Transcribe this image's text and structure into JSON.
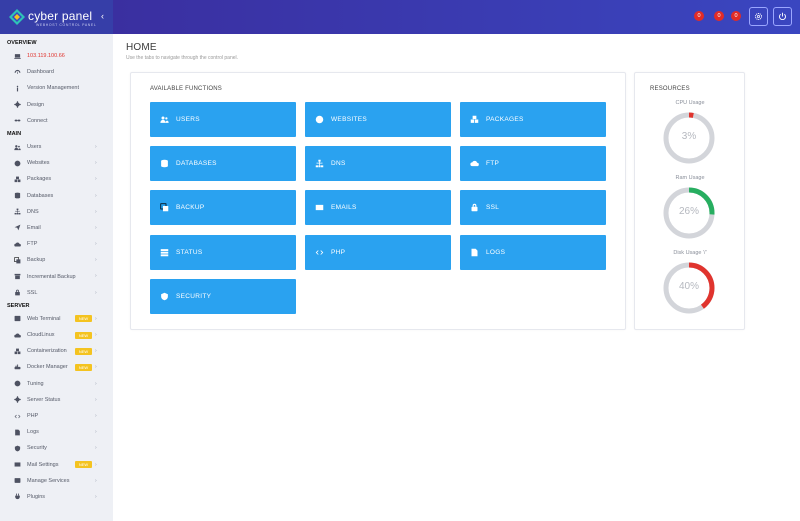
{
  "brand": {
    "name": "cyber panel",
    "tagline": "WEBHOST CONTROL PANEL",
    "collapse_icon": "chevron-left-icon"
  },
  "sidebar": {
    "sections": [
      {
        "title": "OVERVIEW"
      },
      {
        "title": "MAIN"
      },
      {
        "title": "SERVER"
      }
    ],
    "overview": [
      {
        "label": "103.119.100.66",
        "icon": "laptop-icon"
      },
      {
        "label": "Dashboard",
        "icon": "dashboard-icon"
      },
      {
        "label": "Version Management",
        "icon": "info-icon"
      },
      {
        "label": "Design",
        "icon": "gear-icon"
      },
      {
        "label": "Connect",
        "icon": "link-icon"
      }
    ],
    "main": [
      {
        "label": "Users",
        "icon": "users-icon"
      },
      {
        "label": "Websites",
        "icon": "globe-icon"
      },
      {
        "label": "Packages",
        "icon": "cubes-icon"
      },
      {
        "label": "Databases",
        "icon": "database-icon"
      },
      {
        "label": "DNS",
        "icon": "sitemap-icon"
      },
      {
        "label": "Email",
        "icon": "paper-plane-icon"
      },
      {
        "label": "FTP",
        "icon": "cloud-upload-icon"
      },
      {
        "label": "Backup",
        "icon": "copy-icon"
      },
      {
        "label": "Incremental Backup",
        "icon": "archive-icon"
      },
      {
        "label": "SSL",
        "icon": "lock-icon"
      }
    ],
    "server": [
      {
        "label": "Web Terminal",
        "icon": "terminal-icon",
        "badge": "NEW"
      },
      {
        "label": "CloudLinux",
        "icon": "cloud-icon",
        "badge": "NEW"
      },
      {
        "label": "Containerization",
        "icon": "cubes-icon",
        "badge": "NEW"
      },
      {
        "label": "Docker Manager",
        "icon": "docker-icon",
        "badge": "NEW"
      },
      {
        "label": "Tuning",
        "icon": "tuning-icon"
      },
      {
        "label": "Server Status",
        "icon": "cog-icon"
      },
      {
        "label": "PHP",
        "icon": "code-icon"
      },
      {
        "label": "Logs",
        "icon": "file-icon"
      },
      {
        "label": "Security",
        "icon": "shield-icon"
      },
      {
        "label": "Mail Settings",
        "icon": "envelope-icon",
        "badge": "NEW"
      },
      {
        "label": "Manage Services",
        "icon": "services-icon"
      },
      {
        "label": "Plugins",
        "icon": "plug-icon"
      }
    ]
  },
  "header": {
    "notifications": [
      "0",
      "0",
      "0"
    ],
    "settings_icon": "gear-icon",
    "power_icon": "power-icon"
  },
  "page": {
    "title": "HOME",
    "subtitle": "Use the tabs to navigate through the control panel."
  },
  "functions": {
    "title": "AVAILABLE FUNCTIONS",
    "items": [
      {
        "label": "USERS",
        "icon": "users-icon"
      },
      {
        "label": "WEBSITES",
        "icon": "globe-icon"
      },
      {
        "label": "PACKAGES",
        "icon": "cubes-icon"
      },
      {
        "label": "DATABASES",
        "icon": "database-icon"
      },
      {
        "label": "DNS",
        "icon": "sitemap-icon"
      },
      {
        "label": "FTP",
        "icon": "cloud-upload-icon"
      },
      {
        "label": "BACKUP",
        "icon": "copy-icon"
      },
      {
        "label": "EMAILS",
        "icon": "envelope-icon"
      },
      {
        "label": "SSL",
        "icon": "lock-icon"
      },
      {
        "label": "STATUS",
        "icon": "server-icon"
      },
      {
        "label": "PHP",
        "icon": "code-icon"
      },
      {
        "label": "LOGS",
        "icon": "file-icon"
      },
      {
        "label": "SECURITY",
        "icon": "shield-icon"
      }
    ]
  },
  "resources": {
    "title": "RESOURCES",
    "gauges": [
      {
        "label": "CPU Usage",
        "value": "3%",
        "percent": 3,
        "color": "#e0342e"
      },
      {
        "label": "Ram Usage",
        "value": "26%",
        "percent": 26,
        "color": "#27ae60"
      },
      {
        "label": "Disk Usage '/'",
        "value": "40%",
        "percent": 40,
        "color": "#e0342e"
      }
    ]
  },
  "colors": {
    "accent": "#2aa2f0",
    "header": "#3a3fb2",
    "badge": "#f4c320",
    "alert": "#e22b26"
  }
}
